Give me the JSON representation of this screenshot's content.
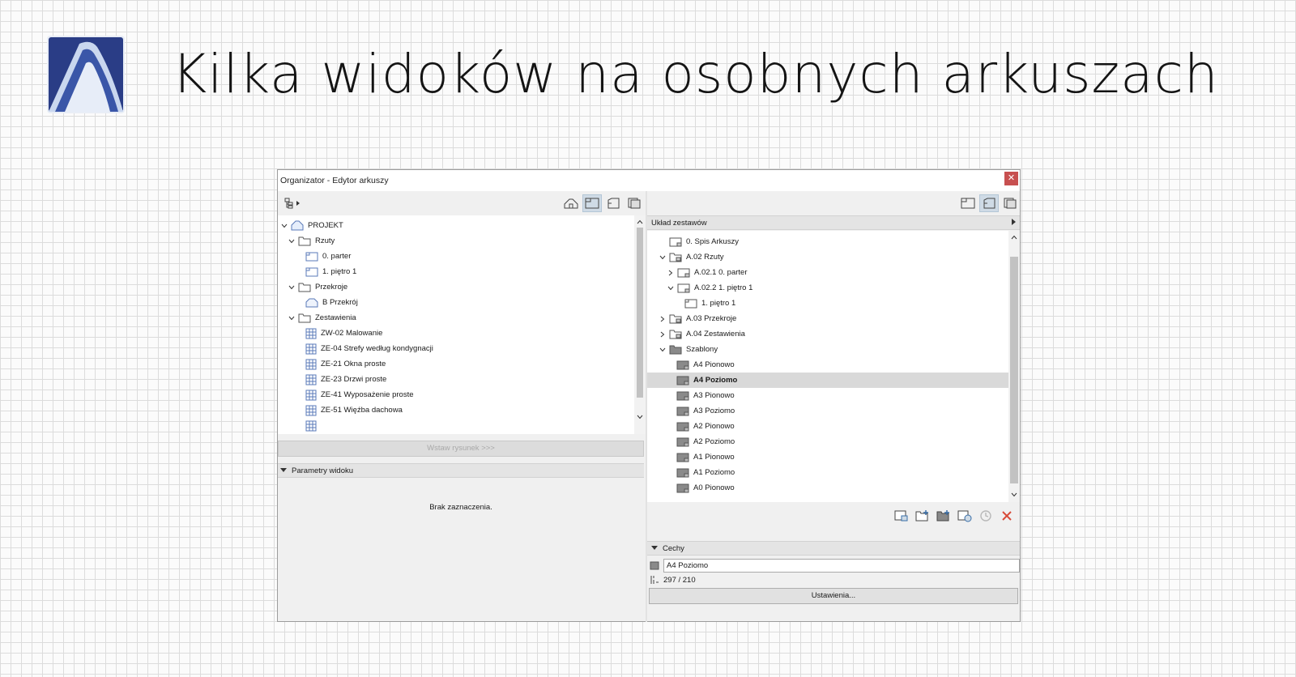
{
  "slide": {
    "title": "Kilka widoków na osobnych arkuszach"
  },
  "window": {
    "title": "Organizator - Edytor arkuszy",
    "close_glyph": "✕"
  },
  "left": {
    "project_label": "PROJEKT",
    "folders": [
      {
        "label": "Rzuty",
        "children": [
          "0. parter",
          "1. piętro 1"
        ]
      },
      {
        "label": "Przekroje",
        "children": [
          "B Przekrój"
        ]
      },
      {
        "label": "Zestawienia",
        "children": [
          "ZW-02 Malowanie",
          "ZE-04 Strefy według kondygnacji",
          "ZE-21 Okna proste",
          "ZE-23 Drzwi proste",
          "ZE-41 Wyposażenie proste",
          "ZE-51 Więźba dachowa"
        ]
      }
    ],
    "insert_button": "Wstaw rysunek >>>",
    "params_header": "Parametry widoku",
    "empty_message": "Brak zaznaczenia."
  },
  "right": {
    "layout_header": "Układ zestawów",
    "tree": [
      {
        "label": "0. Spis Arkuszy"
      },
      {
        "label": "A.02 Rzuty"
      },
      {
        "label": "A.02.1 0. parter"
      },
      {
        "label": "A.02.2 1. piętro 1"
      },
      {
        "label": "1. piętro 1"
      },
      {
        "label": "A.03 Przekroje"
      },
      {
        "label": "A.04 Zestawienia"
      },
      {
        "label": "Szablony"
      },
      {
        "label": "A4 Pionowo"
      },
      {
        "label": "A4 Poziomo"
      },
      {
        "label": "A3 Pionowo"
      },
      {
        "label": "A3 Poziomo"
      },
      {
        "label": "A2 Pionowo"
      },
      {
        "label": "A2 Poziomo"
      },
      {
        "label": "A1 Pionowo"
      },
      {
        "label": "A1 Poziomo"
      },
      {
        "label": "A0 Pionowo"
      }
    ],
    "features_header": "Cechy",
    "name_value": "A4 Poziomo",
    "size_value": "297 / 210",
    "settings_button": "Ustawienia..."
  }
}
